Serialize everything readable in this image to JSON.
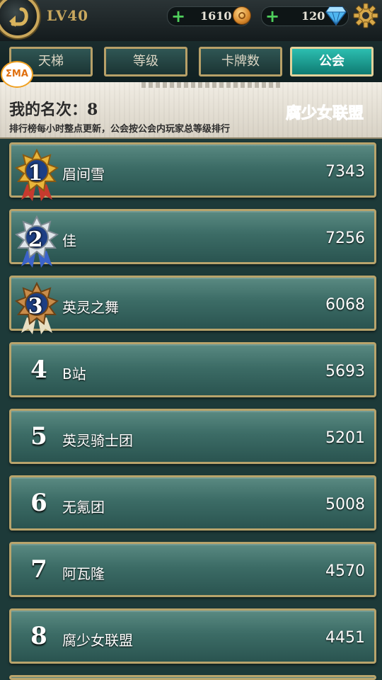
{
  "header": {
    "level": "LV40",
    "gold": "1610",
    "gems": "120",
    "icons": [
      "back-arrow-icon",
      "plus-icon",
      "coin-icon",
      "diamond-icon",
      "gear-icon"
    ]
  },
  "tabs": [
    {
      "label": "天梯",
      "active": false
    },
    {
      "label": "等级",
      "active": false
    },
    {
      "label": "卡牌数",
      "active": false
    },
    {
      "label": "公会",
      "active": true
    }
  ],
  "banner": {
    "logo_text": "ΣMA",
    "my_rank": "我的名次：8",
    "note": "排行榜每小时整点更新，公会按公会内玩家总等级排行",
    "guild_name": "腐少女联盟"
  },
  "ranking": [
    {
      "rank": "1",
      "name": "眉间雪",
      "score": "7343",
      "medal": "gold"
    },
    {
      "rank": "2",
      "name": "佳",
      "score": "7256",
      "medal": "silver"
    },
    {
      "rank": "3",
      "name": "英灵之舞",
      "score": "6068",
      "medal": "bronze"
    },
    {
      "rank": "4",
      "name": "B站",
      "score": "5693"
    },
    {
      "rank": "5",
      "name": "英灵骑士团",
      "score": "5201"
    },
    {
      "rank": "6",
      "name": "无氪团",
      "score": "5008"
    },
    {
      "rank": "7",
      "name": "阿瓦隆",
      "score": "4570"
    },
    {
      "rank": "8",
      "name": "腐少女联盟",
      "score": "4451"
    }
  ],
  "colors": {
    "accent": "#c9a65a",
    "tab_active": "#1fa598",
    "row": "#3c6c66"
  }
}
